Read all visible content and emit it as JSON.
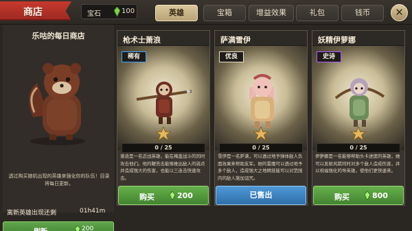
{
  "header": {
    "title": "商店",
    "currency": {
      "label": "宝石",
      "amount": "100",
      "icon": "gem-icon"
    },
    "tabs": [
      {
        "label": "英雄",
        "active": true
      },
      {
        "label": "宝箱",
        "active": false
      },
      {
        "label": "增益效果",
        "active": false
      },
      {
        "label": "礼包",
        "active": false
      },
      {
        "label": "钱币",
        "active": false
      }
    ],
    "close_label": "✕"
  },
  "left_panel": {
    "title": "乐咕的每日商店",
    "promo_text": "透过购买随机出现的英雄来强化你的队伍！目录将每日更新。",
    "refresh_label": "离新英雄出现还剩",
    "refresh_timer": "01h41m",
    "refresh_button": {
      "label": "刷新",
      "price": "200"
    }
  },
  "cards": [
    {
      "name": "枪术士萧浪",
      "rarity": "稀有",
      "rarity_color": "#3fa6ff",
      "progress_text": "0 / 25",
      "progress_fraction": 0,
      "description": "萧浪是一名近战英雄，能在掩盖战斗的同时攻击他们。他的鞭笞击能够推出敌人的弱点并造成强大的伤害，也能以三连击快速攻击。",
      "button": {
        "type": "buy",
        "label": "购买",
        "price": "200"
      }
    },
    {
      "name": "萨满雪伊",
      "rarity": "优良",
      "rarity_color": "#e9e2cf",
      "progress_text": "0 / 25",
      "progress_fraction": 0,
      "description": "雪伊是一名萨满，可以透过地予弹体敌人负面效果来帮助友军。她的雷魔可以透过地予多个敌人，造成强大之地精技能可以对范围内的敌人施加诅咒。",
      "button": {
        "type": "sold",
        "label": "已售出"
      }
    },
    {
      "name": "妖精伊萝娜",
      "rarity": "史诗",
      "rarity_color": "#b05bff",
      "progress_text": "0 / 25",
      "progress_fraction": 0,
      "description": "伊萝娜是一名能够帮助头卡进度的英雄，她可以发射风箭同时对多个敌人造成伤害，并以祝福强化的导英雄，使他们更快速来。",
      "button": {
        "type": "buy",
        "label": "购买",
        "price": "800"
      }
    }
  ]
}
